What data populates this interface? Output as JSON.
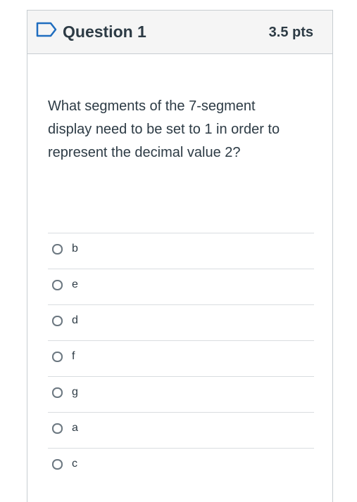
{
  "question": {
    "title": "Question 1",
    "points": "3.5 pts",
    "text": "What segments of the 7-segment display need to be set to 1 in order to represent the decimal value 2?"
  },
  "answers": [
    {
      "label": "b"
    },
    {
      "label": "e"
    },
    {
      "label": "d"
    },
    {
      "label": "f"
    },
    {
      "label": "g"
    },
    {
      "label": "a"
    },
    {
      "label": "c"
    }
  ],
  "colors": {
    "text": "#2d3b45",
    "header_bg": "#f5f5f5",
    "border": "#c7cdd1",
    "flag": "#1f6dbf"
  },
  "icons": {
    "flag": "bookmark-flag-icon",
    "radio": "radio-button-icon"
  }
}
